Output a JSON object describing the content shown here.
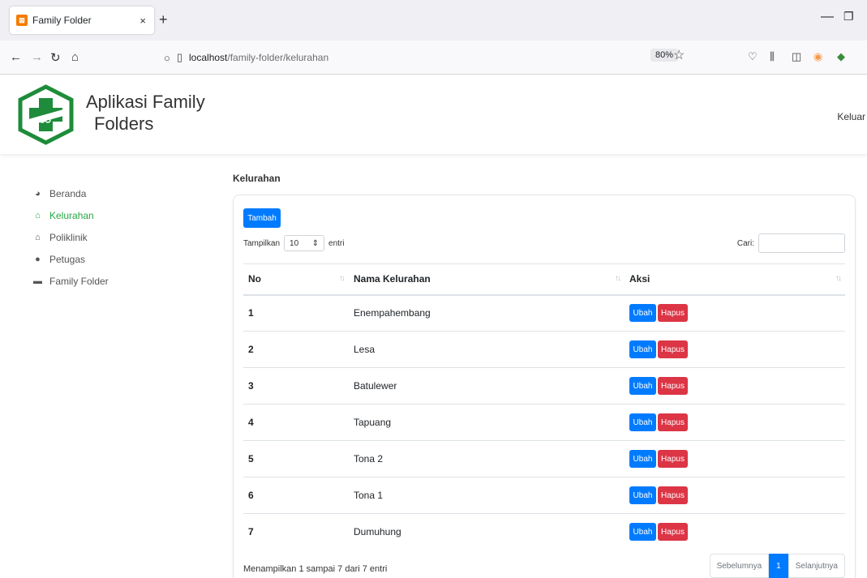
{
  "browser": {
    "tab_title": "Family Folder",
    "tab_close": "×",
    "new_tab": "+",
    "url_host": "localhost",
    "url_path": "/family-folder/kelurahan",
    "zoom": "80%"
  },
  "header": {
    "brand_line1": "Aplikasi Family",
    "brand_line2": "Folders",
    "logout": "Keluar",
    "logo_color": "#1e8c3a"
  },
  "sidebar": {
    "items": [
      {
        "label": "Beranda",
        "icon": "dashboard-icon"
      },
      {
        "label": "Kelurahan",
        "icon": "home-icon",
        "active": true
      },
      {
        "label": "Poliklinik",
        "icon": "home-icon"
      },
      {
        "label": "Petugas",
        "icon": "user-icon"
      },
      {
        "label": "Family Folder",
        "icon": "folder-icon"
      }
    ]
  },
  "main": {
    "title": "Kelurahan",
    "add_button": "Tambah",
    "length_prefix": "Tampilkan",
    "length_value": "10",
    "length_suffix": "entri",
    "search_label": "Cari:",
    "search_value": "",
    "columns": [
      "No",
      "Nama Kelurahan",
      "Aksi"
    ],
    "rows": [
      {
        "no": "1",
        "name": "Enempahembang"
      },
      {
        "no": "2",
        "name": "Lesa"
      },
      {
        "no": "3",
        "name": "Batulewer"
      },
      {
        "no": "4",
        "name": "Tapuang"
      },
      {
        "no": "5",
        "name": "Tona 2"
      },
      {
        "no": "6",
        "name": "Tona 1"
      },
      {
        "no": "7",
        "name": "Dumuhung"
      }
    ],
    "edit_label": "Ubah",
    "delete_label": "Hapus",
    "info": "Menampilkan 1 sampai 7 dari 7 entri",
    "pager": {
      "prev": "Sebelumnya",
      "page": "1",
      "next": "Selanjutnya"
    }
  },
  "colors": {
    "primary": "#007bff",
    "danger": "#dc3545",
    "active_nav": "#28a745"
  }
}
